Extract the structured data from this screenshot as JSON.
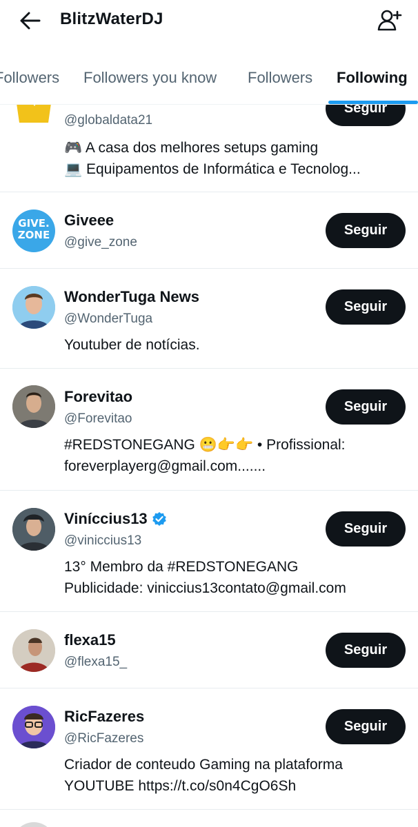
{
  "header": {
    "title": "BlitzWaterDJ"
  },
  "tabs": [
    {
      "label": "Followers"
    },
    {
      "label": "Followers you know"
    },
    {
      "label": "Followers"
    },
    {
      "label": "Following"
    }
  ],
  "button_label": "Seguir",
  "accounts": [
    {
      "name": "",
      "handle": "@globaldata21",
      "bio": [
        "🎮 A casa dos melhores setups gaming",
        "💻 Equipamentos de Informática e Tecnolog..."
      ]
    },
    {
      "name": "Giveee",
      "handle": "@give_zone",
      "bio": [],
      "avatar_text": [
        "GIVE.",
        "ZONE"
      ]
    },
    {
      "name": "WonderTuga News",
      "handle": "@WonderTuga",
      "bio": [
        "Youtuber de notícias."
      ]
    },
    {
      "name": "Forevitao",
      "handle": "@Forevitao",
      "bio": [
        "#REDSTONEGANG 😬👉👉 • Profissional:",
        "foreverplayerg@gmail.com......."
      ]
    },
    {
      "name": "Viníccius13",
      "handle": "@viniccius13",
      "verified": true,
      "bio": [
        "13° Membro da #REDSTONEGANG",
        "Publicidade: viniccius13contato@gmail.com"
      ]
    },
    {
      "name": "flexa15",
      "handle": "@flexa15_",
      "bio": []
    },
    {
      "name": "RicFazeres",
      "handle": "@RicFazeres",
      "bio": [
        "Criador de conteudo Gaming na plataforma",
        "YOUTUBE https://t.co/s0n4CgO6Sh"
      ]
    }
  ],
  "colors": {
    "accent": "#1d9bf0",
    "button_bg": "#0f1419",
    "secondary_text": "#536471"
  }
}
